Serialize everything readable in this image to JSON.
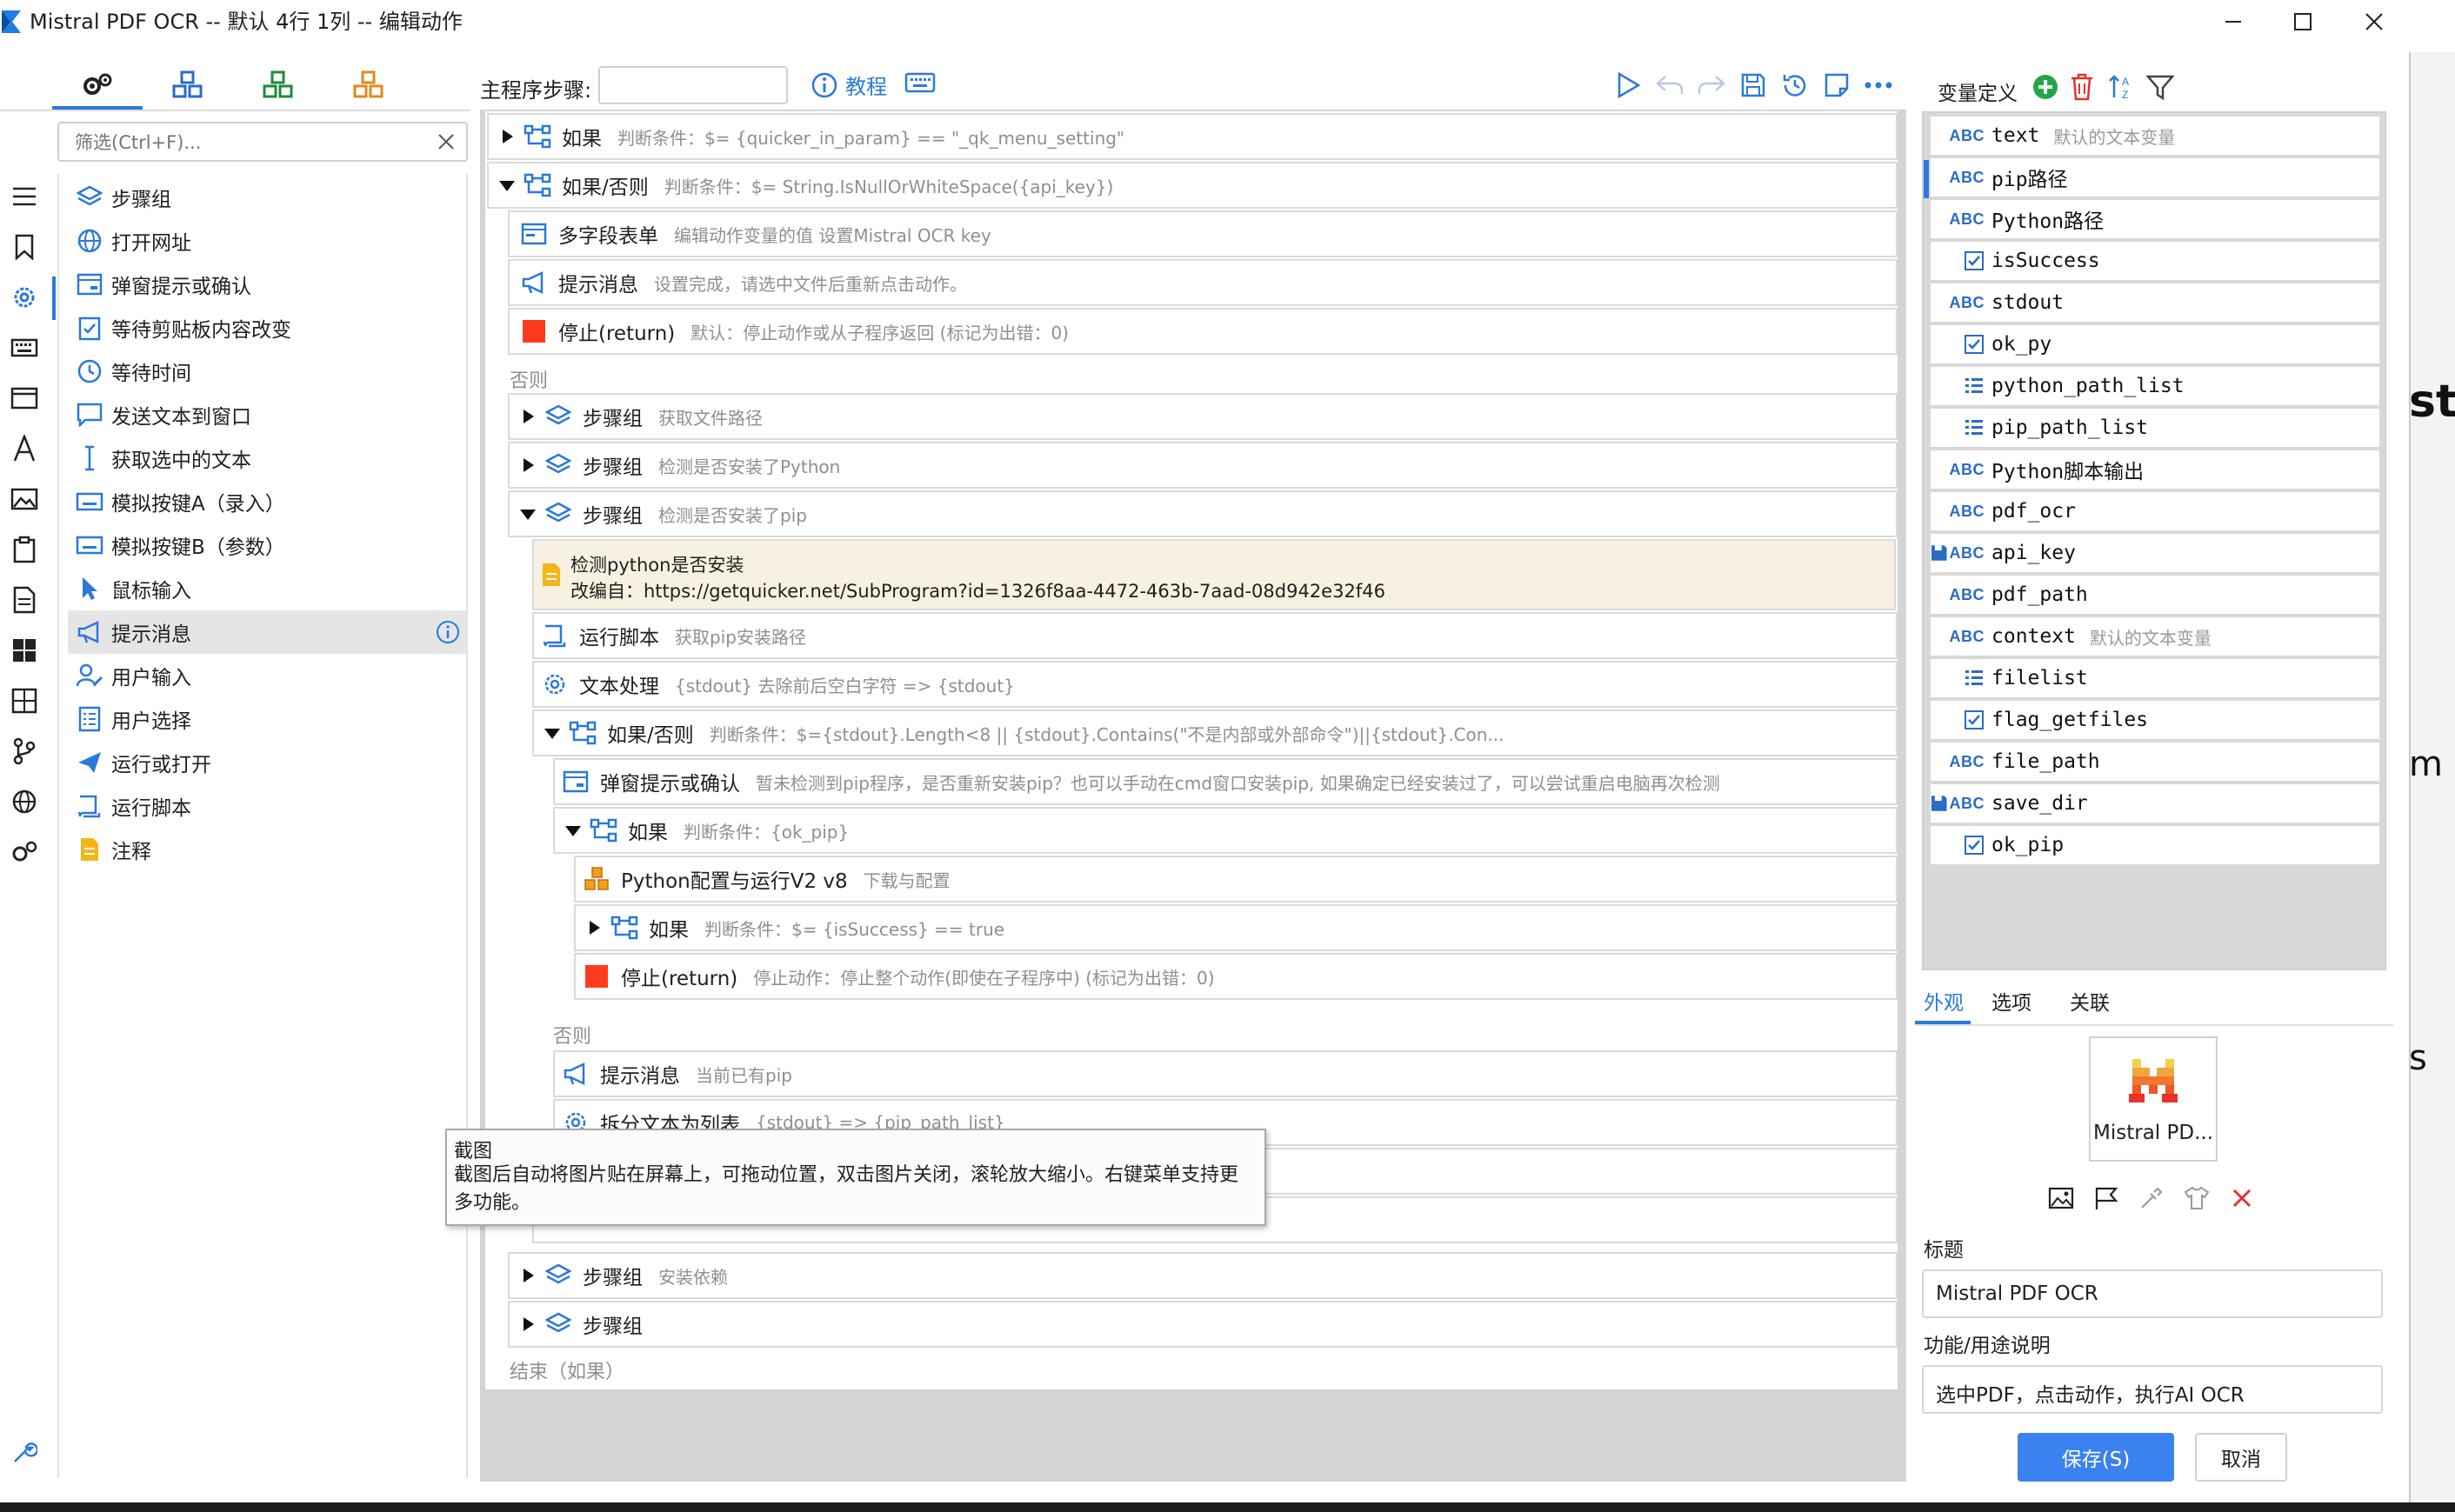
{
  "window": {
    "title": "Mistral PDF OCR -- 默认 4行 1列 -- 编辑动作"
  },
  "left_panel": {
    "filter_placeholder": "筛选(Ctrl+F)...",
    "actions": [
      {
        "label": "步骤组",
        "icon": "layers-icon"
      },
      {
        "label": "打开网址",
        "icon": "globe-icon"
      },
      {
        "label": "弹窗提示或确认",
        "icon": "dialog-icon"
      },
      {
        "label": "等待剪贴板内容改变",
        "icon": "clipboard-check-icon"
      },
      {
        "label": "等待时间",
        "icon": "clock-icon"
      },
      {
        "label": "发送文本到窗口",
        "icon": "chat-icon"
      },
      {
        "label": "获取选中的文本",
        "icon": "text-cursor-icon"
      },
      {
        "label": "模拟按键A（录入）",
        "icon": "keyboard-icon"
      },
      {
        "label": "模拟按键B（参数）",
        "icon": "keyboard-icon"
      },
      {
        "label": "鼠标输入",
        "icon": "mouse-pointer-icon"
      },
      {
        "label": "提示消息",
        "icon": "megaphone-icon"
      },
      {
        "label": "用户输入",
        "icon": "user-edit-icon"
      },
      {
        "label": "用户选择",
        "icon": "checklist-icon"
      },
      {
        "label": "运行或打开",
        "icon": "paper-plane-icon"
      },
      {
        "label": "运行脚本",
        "icon": "script-icon"
      },
      {
        "label": "注释",
        "icon": "note-icon"
      }
    ],
    "selected_index": 10
  },
  "toolbar": {
    "main_steps_label": "主程序步骤:",
    "main_steps_value": "",
    "tutorial_label": "教程"
  },
  "steps": {
    "r0": {
      "title": "如果",
      "desc": "判断条件：$= {quicker_in_param} == \"_qk_menu_setting\"",
      "icon": "branch-icon"
    },
    "r1": {
      "title": "如果/否则",
      "desc": "判断条件：$= String.IsNullOrWhiteSpace({api_key})",
      "icon": "branch-icon"
    },
    "r2": {
      "title": "多字段表单",
      "desc": "编辑动作变量的值 设置Mistral OCR key",
      "icon": "form-icon"
    },
    "r3": {
      "title": "提示消息",
      "desc": "设置完成，请选中文件后重新点击动作。",
      "icon": "megaphone-icon"
    },
    "r4": {
      "title": "停止(return)",
      "desc": "默认：停止动作或从子程序返回 (标记为出错：0)",
      "icon": "stop-icon"
    },
    "else1": "否则",
    "r5": {
      "title": "步骤组",
      "desc": "获取文件路径",
      "icon": "layers-icon"
    },
    "r6": {
      "title": "步骤组",
      "desc": "检测是否安装了Python",
      "icon": "layers-icon"
    },
    "r7": {
      "title": "步骤组",
      "desc": "检测是否安装了pip",
      "icon": "layers-icon"
    },
    "note": {
      "line1": "检测python是否安装",
      "line2": "改编自：https://getquicker.net/SubProgram?id=1326f8aa-4472-463b-7aad-08d942e32f46"
    },
    "r8": {
      "title": "运行脚本",
      "desc": "获取pip安装路径",
      "icon": "script-icon"
    },
    "r9": {
      "title": "文本处理",
      "desc": "{stdout} 去除前后空白字符 => {stdout}",
      "icon": "gear-icon"
    },
    "r10": {
      "title": "如果/否则",
      "desc": "判断条件：$={stdout}.Length<8 || {stdout}.Contains(\"不是内部或外部命令\")||{stdout}.Con...",
      "icon": "branch-icon"
    },
    "r11": {
      "title": "弹窗提示或确认",
      "desc": "暂未检测到pip程序，是否重新安装pip？也可以手动在cmd窗口安装pip, 如果确定已经安装过了，可以尝试重启电脑再次检测",
      "icon": "dialog-icon"
    },
    "r12": {
      "title": "如果",
      "desc": "判断条件：{ok_pip}",
      "icon": "branch-icon"
    },
    "r13": {
      "title": "Python配置与运行V2 v8",
      "desc": "下载与配置",
      "icon": "subprogram-icon"
    },
    "r14": {
      "title": "如果",
      "desc": "判断条件：$= {isSuccess} == true",
      "icon": "branch-icon"
    },
    "r15": {
      "title": "停止(return)",
      "desc": "停止动作：停止整个动作(即使在子程序中) (标记为出错：0)",
      "icon": "stop-icon"
    },
    "else2": "否则",
    "r16": {
      "title": "提示消息",
      "desc": "当前已有pip",
      "icon": "megaphone-icon"
    },
    "r17": {
      "title": "拆分文本为列表",
      "desc": "{stdout} => {pip_path_list}",
      "icon": "gear-icon"
    },
    "r20": {
      "title": "步骤组",
      "desc": "安装依赖",
      "icon": "layers-icon"
    },
    "r21": {
      "title": "步骤组",
      "desc": "",
      "icon": "layers-icon"
    },
    "end": "结束（如果）"
  },
  "tooltip": {
    "title": "截图",
    "body": "截图后自动将图片贴在屏幕上，可拖动位置，双击图片关闭，滚轮放大缩小。右键菜单支持更多功能。"
  },
  "variables": {
    "header": "变量定义",
    "items": [
      {
        "name": "text",
        "type": "ABC",
        "desc": "默认的文本变量"
      },
      {
        "name": "pip路径",
        "type": "ABC",
        "desc": ""
      },
      {
        "name": "Python路径",
        "type": "ABC",
        "desc": ""
      },
      {
        "name": "isSuccess",
        "type": "bool",
        "desc": ""
      },
      {
        "name": "stdout",
        "type": "ABC",
        "desc": ""
      },
      {
        "name": "ok_py",
        "type": "bool",
        "desc": ""
      },
      {
        "name": "python_path_list",
        "type": "list",
        "desc": ""
      },
      {
        "name": "pip_path_list",
        "type": "list",
        "desc": ""
      },
      {
        "name": "Python脚本输出",
        "type": "ABC",
        "desc": ""
      },
      {
        "name": "pdf_ocr",
        "type": "ABC",
        "desc": ""
      },
      {
        "name": "api_key",
        "type": "ABC-saved",
        "desc": ""
      },
      {
        "name": "pdf_path",
        "type": "ABC",
        "desc": ""
      },
      {
        "name": "context",
        "type": "ABC",
        "desc": "默认的文本变量"
      },
      {
        "name": "filelist",
        "type": "list",
        "desc": ""
      },
      {
        "name": "flag_getfiles",
        "type": "bool",
        "desc": ""
      },
      {
        "name": "file_path",
        "type": "ABC",
        "desc": ""
      },
      {
        "name": "save_dir",
        "type": "ABC-saved",
        "desc": ""
      },
      {
        "name": "ok_pip",
        "type": "bool",
        "desc": ""
      }
    ],
    "type_badge": "ABC"
  },
  "props": {
    "tabs": [
      "外观",
      "选项",
      "关联"
    ],
    "icon_label": "Mistral PD...",
    "title_label": "标题",
    "title_value": "Mistral PDF OCR",
    "desc_label": "功能/用途说明",
    "desc_value": "选中PDF，点击动作，执行AI OCR"
  },
  "buttons": {
    "save": "保存(S)",
    "cancel": "取消"
  },
  "background_window_fragments": [
    "st",
    "m",
    "s"
  ],
  "colors": {
    "accent": "#2b79d9",
    "stop_red": "#ff3b1f",
    "add_green": "#21a64a",
    "delete_red": "#e0352b",
    "note_bg": "#f7f1e2"
  }
}
